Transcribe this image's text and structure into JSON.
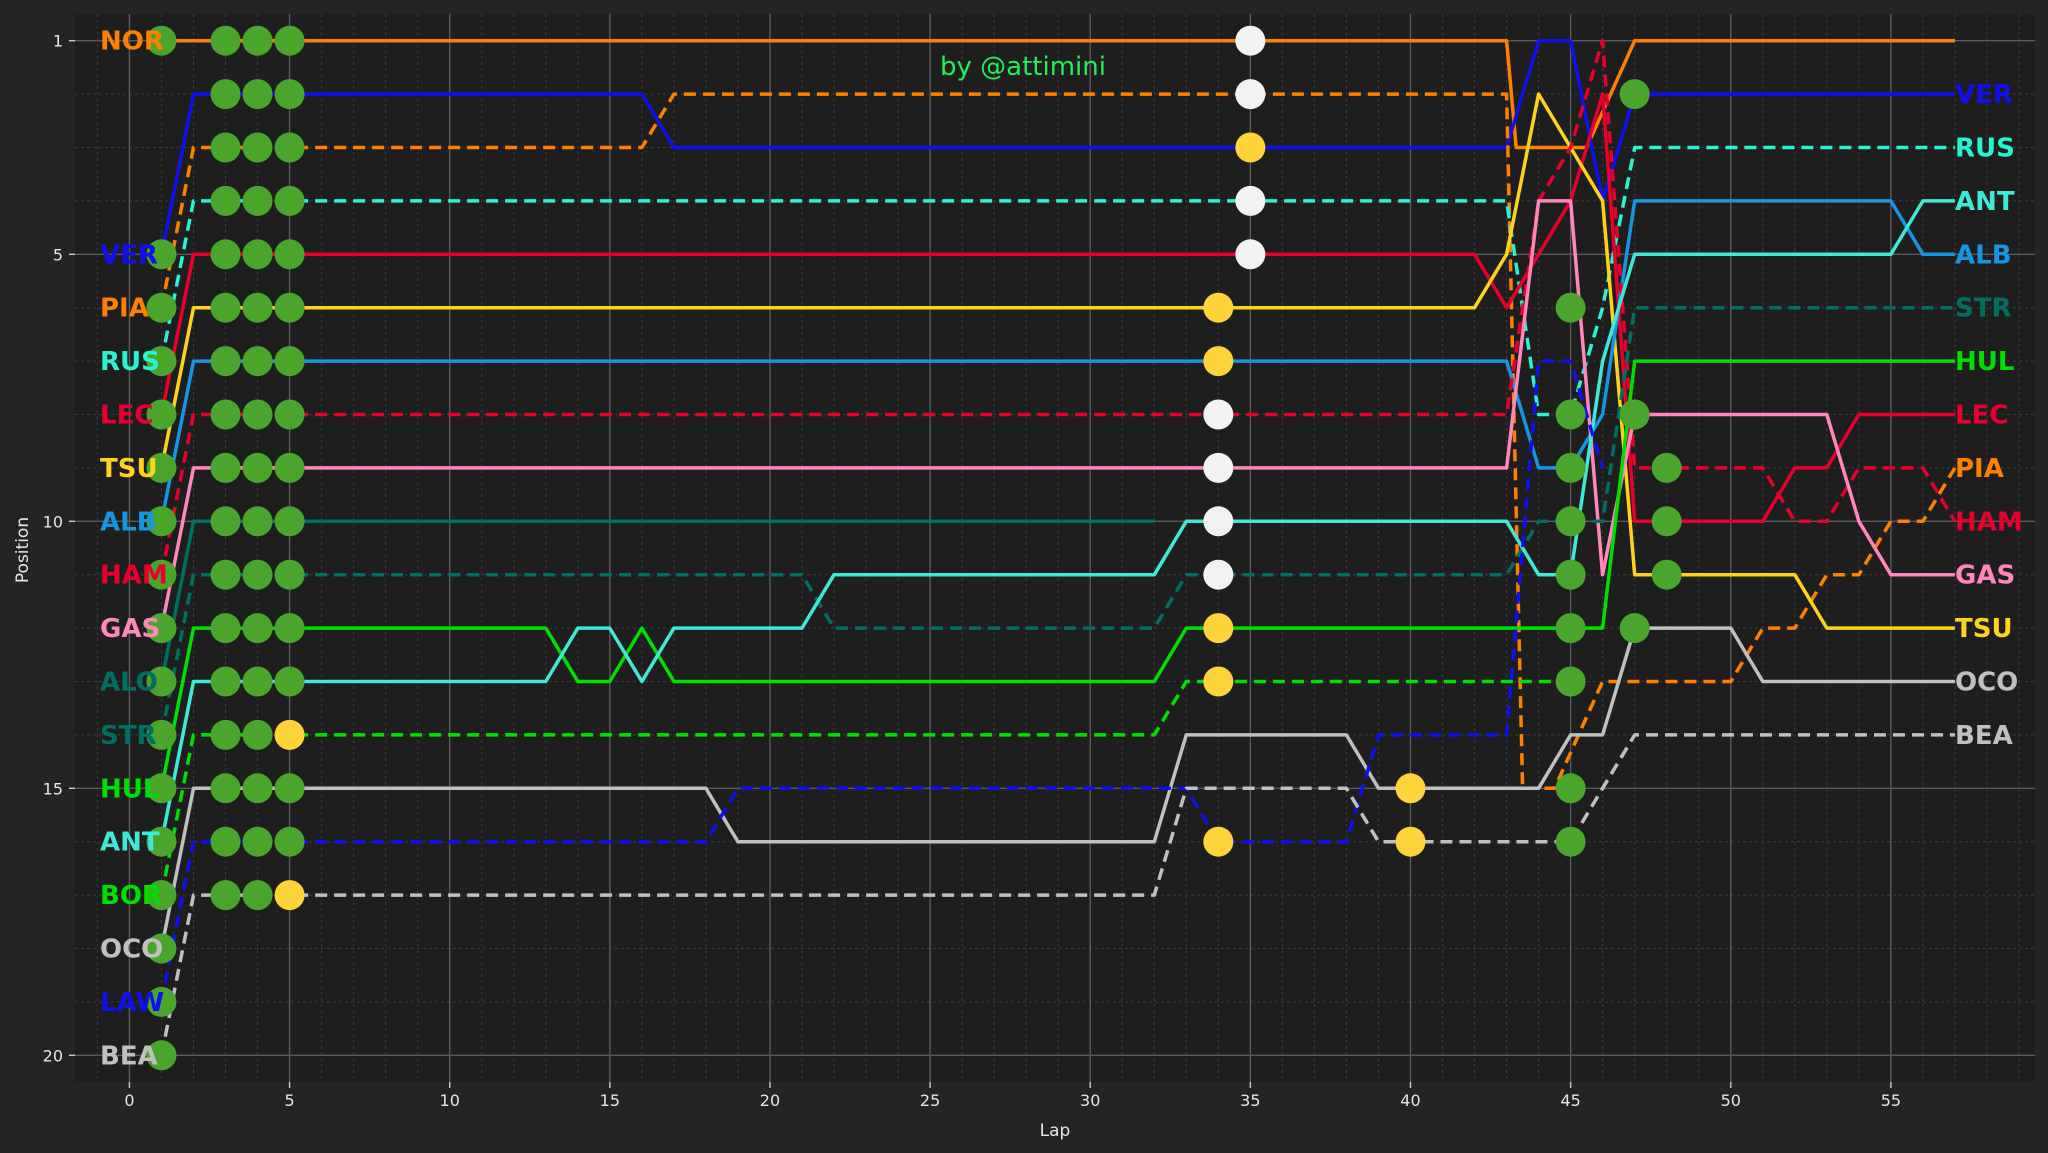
{
  "chart_data": {
    "type": "line",
    "xlabel": "Lap",
    "ylabel": "Position",
    "credit": "by @attimini",
    "xlim": [
      -1.7,
      59.5
    ],
    "ylim": [
      20.5,
      0.5
    ],
    "xticks": [
      0,
      5,
      10,
      15,
      20,
      25,
      30,
      35,
      40,
      45,
      50,
      55
    ],
    "yticks": [
      1,
      5,
      10,
      15,
      20
    ],
    "grid": true,
    "colors": {
      "background": "#1e1e1e",
      "figure": "#262422",
      "credit": "#22ee55",
      "pit_marker": "#4aa52d"
    },
    "start_labels": [
      "NOR",
      "VER",
      "PIA",
      "RUS",
      "LEC",
      "TSU",
      "ALB",
      "HAM",
      "GAS",
      "ALO",
      "STR",
      "HUL",
      "ANT",
      "BOR",
      "OCO",
      "LAW",
      "BEA"
    ],
    "start_positions": [
      1,
      5,
      6,
      7,
      8,
      9,
      10,
      11,
      12,
      13,
      14,
      15,
      16,
      17,
      18,
      19,
      20
    ],
    "series": [
      {
        "name": "NOR",
        "color": "#ff8000",
        "dash": false,
        "points": [
          [
            1,
            1
          ],
          [
            43,
            1
          ],
          [
            43.3,
            3
          ],
          [
            45.5,
            3
          ],
          [
            47,
            1
          ],
          [
            57,
            1
          ]
        ]
      },
      {
        "name": "VER",
        "color": "#1010ee",
        "dash": false,
        "points": [
          [
            1,
            5
          ],
          [
            2,
            2
          ],
          [
            16,
            2
          ],
          [
            17,
            3
          ],
          [
            43,
            3
          ],
          [
            44,
            1
          ],
          [
            45,
            1
          ],
          [
            46,
            4
          ],
          [
            47,
            2
          ],
          [
            57,
            2
          ]
        ]
      },
      {
        "name": "PIA",
        "color": "#ff8000",
        "dash": true,
        "points": [
          [
            1,
            6
          ],
          [
            2,
            3
          ],
          [
            16,
            3
          ],
          [
            17,
            2
          ],
          [
            43,
            2
          ],
          [
            43.5,
            15
          ],
          [
            44.5,
            15
          ],
          [
            46,
            13
          ],
          [
            47,
            13
          ],
          [
            50,
            13
          ],
          [
            51,
            12
          ],
          [
            52,
            12
          ],
          [
            53,
            11
          ],
          [
            54,
            11
          ],
          [
            55,
            10
          ],
          [
            56,
            10
          ],
          [
            57,
            9
          ]
        ]
      },
      {
        "name": "RUS",
        "color": "#27f4d2",
        "dash": true,
        "points": [
          [
            1,
            7
          ],
          [
            2,
            4
          ],
          [
            43,
            4
          ],
          [
            44,
            8
          ],
          [
            45,
            8
          ],
          [
            46,
            6
          ],
          [
            47,
            3
          ],
          [
            57,
            3
          ]
        ]
      },
      {
        "name": "LEC",
        "color": "#e8002d",
        "dash": false,
        "points": [
          [
            1,
            8
          ],
          [
            2,
            5
          ],
          [
            42,
            5
          ],
          [
            43,
            6
          ],
          [
            44,
            5
          ],
          [
            45,
            4
          ],
          [
            46,
            2
          ],
          [
            47,
            10
          ],
          [
            51,
            10
          ],
          [
            52,
            9
          ],
          [
            53,
            9
          ],
          [
            54,
            8
          ],
          [
            57,
            8
          ]
        ]
      },
      {
        "name": "TSU",
        "color": "#ffd21e",
        "dash": false,
        "points": [
          [
            1,
            9
          ],
          [
            2,
            6
          ],
          [
            42,
            6
          ],
          [
            43,
            5
          ],
          [
            44,
            2
          ],
          [
            45,
            3
          ],
          [
            46,
            4
          ],
          [
            47,
            11
          ],
          [
            51,
            11
          ],
          [
            52,
            11
          ],
          [
            53,
            12
          ],
          [
            57,
            12
          ]
        ]
      },
      {
        "name": "ALB",
        "color": "#1696e2",
        "dash": false,
        "points": [
          [
            1,
            10
          ],
          [
            2,
            7
          ],
          [
            43,
            7
          ],
          [
            44,
            9
          ],
          [
            45,
            9
          ],
          [
            46,
            8
          ],
          [
            47,
            4
          ],
          [
            55,
            4
          ],
          [
            56,
            5
          ],
          [
            57,
            5
          ]
        ]
      },
      {
        "name": "HAM",
        "color": "#e8002d",
        "dash": true,
        "points": [
          [
            1,
            11
          ],
          [
            2,
            8
          ],
          [
            43,
            8
          ],
          [
            44,
            4
          ],
          [
            45,
            3
          ],
          [
            46,
            1
          ],
          [
            47,
            9
          ],
          [
            51,
            9
          ],
          [
            52,
            10
          ],
          [
            53,
            10
          ],
          [
            54,
            9
          ],
          [
            56,
            9
          ],
          [
            57,
            10
          ]
        ]
      },
      {
        "name": "GAS",
        "color": "#ff87bc",
        "dash": false,
        "points": [
          [
            1,
            12
          ],
          [
            2,
            9
          ],
          [
            43,
            9
          ],
          [
            44,
            4
          ],
          [
            45,
            4
          ],
          [
            46,
            11
          ],
          [
            47,
            8
          ],
          [
            53,
            8
          ],
          [
            54,
            10
          ],
          [
            55,
            11
          ],
          [
            57,
            11
          ]
        ]
      },
      {
        "name": "ALO",
        "color": "#006f62",
        "dash": false,
        "points": [
          [
            1,
            13
          ],
          [
            2,
            10
          ],
          [
            32,
            10
          ]
        ]
      },
      {
        "name": "STR",
        "color": "#006f62",
        "dash": true,
        "points": [
          [
            1,
            14
          ],
          [
            2,
            11
          ],
          [
            21,
            11
          ],
          [
            22,
            12
          ],
          [
            32,
            12
          ],
          [
            33,
            11
          ],
          [
            43,
            11
          ],
          [
            44,
            10
          ],
          [
            46,
            10
          ],
          [
            47,
            6
          ],
          [
            57,
            6
          ]
        ]
      },
      {
        "name": "HUL",
        "color": "#00e000",
        "dash": false,
        "points": [
          [
            1,
            15
          ],
          [
            2,
            12
          ],
          [
            13,
            12
          ],
          [
            14,
            13
          ],
          [
            15,
            13
          ],
          [
            16,
            12
          ],
          [
            17,
            13
          ],
          [
            32,
            13
          ],
          [
            33,
            12
          ],
          [
            46,
            12
          ],
          [
            47,
            7
          ],
          [
            57,
            7
          ]
        ]
      },
      {
        "name": "ANT",
        "color": "#40e8d8",
        "dash": false,
        "points": [
          [
            1,
            16
          ],
          [
            2,
            13
          ],
          [
            13,
            13
          ],
          [
            14,
            12
          ],
          [
            15,
            12
          ],
          [
            16,
            13
          ],
          [
            17,
            12
          ],
          [
            21,
            12
          ],
          [
            22,
            11
          ],
          [
            32,
            11
          ],
          [
            33,
            10
          ],
          [
            43,
            10
          ],
          [
            44,
            11
          ],
          [
            45,
            11
          ],
          [
            46,
            7
          ],
          [
            47,
            5
          ],
          [
            55,
            5
          ],
          [
            56,
            4
          ],
          [
            57,
            4
          ]
        ]
      },
      {
        "name": "BOR",
        "color": "#00e000",
        "dash": true,
        "points": [
          [
            1,
            17
          ],
          [
            2,
            14
          ],
          [
            32,
            14
          ],
          [
            33,
            13
          ],
          [
            45,
            13
          ]
        ]
      },
      {
        "name": "OCO",
        "color": "#c0c0c0",
        "dash": false,
        "points": [
          [
            1,
            18
          ],
          [
            2,
            15
          ],
          [
            18,
            15
          ],
          [
            19,
            16
          ],
          [
            32,
            16
          ],
          [
            33,
            14
          ],
          [
            38,
            14
          ],
          [
            39,
            15
          ],
          [
            44,
            15
          ],
          [
            45,
            14
          ],
          [
            46,
            14
          ],
          [
            47,
            12
          ],
          [
            50,
            12
          ],
          [
            51,
            13
          ],
          [
            57,
            13
          ]
        ]
      },
      {
        "name": "LAW",
        "color": "#1010ee",
        "dash": true,
        "points": [
          [
            1,
            19
          ],
          [
            2,
            16
          ],
          [
            18,
            16
          ],
          [
            19,
            15
          ],
          [
            33,
            15
          ],
          [
            34,
            16
          ],
          [
            38,
            16
          ],
          [
            39,
            14
          ],
          [
            43,
            14
          ],
          [
            44,
            7
          ],
          [
            45,
            7
          ],
          [
            46,
            9
          ]
        ]
      },
      {
        "name": "BEA",
        "color": "#c0c0c0",
        "dash": true,
        "points": [
          [
            1,
            20
          ],
          [
            2,
            17
          ],
          [
            32,
            17
          ],
          [
            33,
            15
          ],
          [
            38,
            15
          ],
          [
            39,
            16
          ],
          [
            45,
            16
          ],
          [
            46,
            15
          ],
          [
            47,
            14
          ],
          [
            57,
            14
          ]
        ]
      }
    ],
    "end_labels": [
      {
        "name": "VER",
        "color": "#1010ee",
        "position": 2
      },
      {
        "name": "RUS",
        "color": "#27f4d2",
        "position": 3
      },
      {
        "name": "ANT",
        "color": "#40e8d8",
        "position": 4
      },
      {
        "name": "ALB",
        "color": "#1696e2",
        "position": 5
      },
      {
        "name": "STR",
        "color": "#006f62",
        "position": 6
      },
      {
        "name": "HUL",
        "color": "#00e000",
        "position": 7
      },
      {
        "name": "LEC",
        "color": "#e8002d",
        "position": 8
      },
      {
        "name": "PIA",
        "color": "#ff8000",
        "position": 9
      },
      {
        "name": "HAM",
        "color": "#e8002d",
        "position": 10
      },
      {
        "name": "GAS",
        "color": "#ff87bc",
        "position": 11
      },
      {
        "name": "TSU",
        "color": "#ffd21e",
        "position": 12
      },
      {
        "name": "OCO",
        "color": "#c0c0c0",
        "position": 13
      },
      {
        "name": "BEA",
        "color": "#c0c0c0",
        "position": 14
      }
    ],
    "pit_markers": [
      {
        "lap": 1,
        "positions": [
          1,
          5,
          6,
          7,
          8,
          9,
          10,
          11,
          12,
          13,
          14,
          15,
          16,
          17,
          18,
          19,
          20
        ],
        "color": "#4aa52d"
      },
      {
        "lap": 3,
        "positions": [
          1,
          2,
          3,
          4,
          5,
          6,
          7,
          8,
          9,
          10,
          11,
          12,
          13,
          14,
          15,
          16,
          17
        ],
        "color": "#4aa52d"
      },
      {
        "lap": 4,
        "positions": [
          1,
          2,
          3,
          4,
          5,
          6,
          7,
          8,
          9,
          10,
          11,
          12,
          13,
          15,
          16,
          17
        ],
        "color": "#4aa52d"
      },
      {
        "lap": 4,
        "positions": [
          14
        ],
        "color": "#4aa52d"
      },
      {
        "lap": 5,
        "positions": [
          1,
          2,
          3,
          4,
          5,
          6,
          7,
          8,
          9,
          10,
          11,
          12,
          13,
          15,
          16
        ],
        "color": "#4aa52d"
      },
      {
        "lap": 5,
        "positions": [
          14,
          17
        ],
        "color": "#ffd43b"
      },
      {
        "lap": 34,
        "positions": [
          6,
          7,
          12,
          13,
          16
        ],
        "color": "#ffd43b"
      },
      {
        "lap": 34,
        "positions": [
          8,
          9,
          10,
          11
        ],
        "color": "#f2f2f2"
      },
      {
        "lap": 35,
        "positions": [
          1,
          2,
          4,
          5
        ],
        "color": "#f2f2f2"
      },
      {
        "lap": 35,
        "positions": [
          3
        ],
        "color": "#ffd43b"
      },
      {
        "lap": 40,
        "positions": [
          15,
          16
        ],
        "color": "#ffd43b"
      },
      {
        "lap": 45,
        "positions": [
          6,
          8,
          9,
          10,
          11,
          12,
          13,
          15,
          16
        ],
        "color": "#4aa52d"
      },
      {
        "lap": 47,
        "positions": [
          2,
          8,
          12
        ],
        "color": "#4aa52d"
      },
      {
        "lap": 48,
        "positions": [
          9,
          10,
          11
        ],
        "color": "#4aa52d"
      }
    ]
  }
}
